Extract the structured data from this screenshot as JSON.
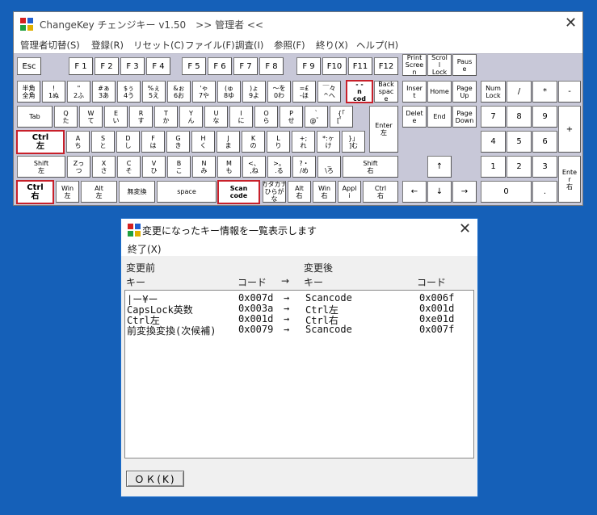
{
  "main_window": {
    "title": "ChangeKey チェンジキー v1.50　>> 管理者 <<",
    "close_glyph": "✕",
    "menu": [
      "管理者切替(S)",
      "登録(R)",
      "リセット(C)",
      "ファイル(F)",
      "調査(I)",
      "参照(F)",
      "終り(X)",
      "ヘルプ(H)"
    ]
  },
  "keys": {
    "esc": "Esc",
    "f1": "F 1",
    "f2": "F 2",
    "f3": "F 3",
    "f4": "F 4",
    "f5": "F 5",
    "f6": "F 6",
    "f7": "F 7",
    "f8": "F 8",
    "f9": "F 9",
    "f10": "F10",
    "f11": "F11",
    "f12": "F12",
    "prtsc": "Print\nScree\nn",
    "scrlk": "Scrol\nl\nLock",
    "pause": "Paus\ne",
    "hankaku": "半角\n全角",
    "k1": "!\n1ぬ",
    "k2": "\"\n2ふ",
    "k3": "#ぁ\n3あ",
    "k4": "$ぅ\n4う",
    "k5": "%ぇ\n5え",
    "k6": "&ぉ\n6お",
    "k7": "'ゃ\n7や",
    "k8": "(ゅ\n8ゆ",
    "k9": ")ょ\n9よ",
    "k0": "〜を\n0わ",
    "kminus": "=£\n-ほ",
    "kcaret": "￣々\n^へ",
    "kyen": "- -\nn\ncod",
    "bksp": "Back\nspac\ne",
    "ins": "Inser\nt",
    "home": "Home",
    "pgup": "Page\nUp",
    "numlk": "Num\nLock",
    "nslash": "/",
    "nstar": "*",
    "nminus": "-",
    "tab": "Tab",
    "q": "Q\nた",
    "w": "W\nて",
    "e": "E\nい",
    "r": "R\nす",
    "t": "T\nか",
    "y": "Y\nん",
    "u": "U\nな",
    "i": "I\nに",
    "o": "O\nら",
    "p": "P\nせ",
    "at": "`\n@゛",
    "lbr": "{「\n[゜",
    "enter": "Enter\n左",
    "del": "Delet\ne",
    "end": "End",
    "pgdn": "Page\nDown",
    "n7": "7",
    "n8": "8",
    "n9": "9",
    "nplus": "+",
    "ctrl_l": "Ctrl\n左",
    "a": "A\nち",
    "s": "S\nと",
    "d": "D\nし",
    "f": "F\nは",
    "g": "G\nき",
    "h": "H\nく",
    "j": "J\nま",
    "k": "K\nの",
    "l": "L\nり",
    "semi": "+;\nれ",
    "colon": "*:ヶ\nけ",
    "rbr": "}」\n]む",
    "n4": "4",
    "n5": "5",
    "n6": "6",
    "shift_l": "Shift\n左",
    "z": "Zっ\nつ",
    "x": "X\nさ",
    "c": "C\nそ",
    "v": "V\nひ",
    "b": "B\nこ",
    "n": "N\nみ",
    "m": "M\nも",
    "comma": "<、\n,ね",
    "period": ">。\n.る",
    "slash": "?・\n/め",
    "bslash": "_\n\\ろ",
    "shift_r": "Shift\n右",
    "up": "↑",
    "n1": "1",
    "n2": "2",
    "n3": "3",
    "nenter": "Ente\nr\n右",
    "ctrl_l2": "Ctrl\n右",
    "win_l": "Win\n左",
    "alt_l": "Alt\n左",
    "muhenkan": "無変換",
    "space": "space",
    "scancode": "Scan\ncode",
    "kana": "カタカナ\nひらが\nな",
    "alt_r": "Alt\n右",
    "win_r": "Win\n右",
    "apps": "Appl\ni",
    "ctrl_r": "Ctrl\n右",
    "left": "←",
    "down": "↓",
    "right": "→",
    "n0": "0",
    "ndot": "."
  },
  "dialog": {
    "title": "変更になったキー情報を一覧表示します",
    "close_glyph": "✕",
    "menu": "終了(X)",
    "header_before": "変更前",
    "header_after": "変更後",
    "col_key": "キー",
    "col_code": "コード",
    "col_arrow": "→",
    "col_key2": "キー",
    "col_code2": "コード",
    "rows": [
      [
        "|ー¥ー",
        "0x007d",
        "→",
        "Scancode",
        "0x006f"
      ],
      [
        "CapsLock英数",
        "0x003a",
        "→",
        "Ctrl左",
        "0x001d"
      ],
      [
        "Ctrl左",
        "0x001d",
        "→",
        "Ctrl右",
        "0xe01d"
      ],
      [
        "前変換変換(次候補)",
        "0x0079",
        "→",
        "Scancode",
        "0x007f"
      ]
    ],
    "ok_label": "ＯＫ(K)"
  }
}
